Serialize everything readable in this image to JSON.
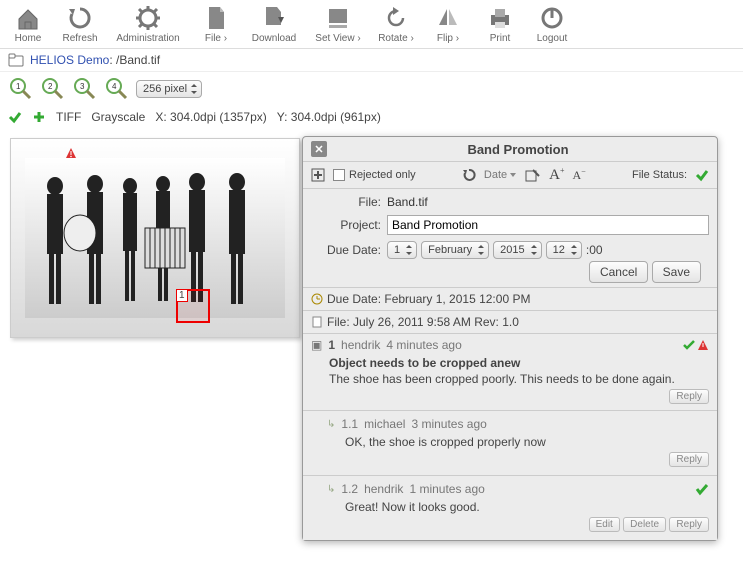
{
  "toolbar": [
    {
      "label": "Home"
    },
    {
      "label": "Refresh"
    },
    {
      "label": "Administration"
    },
    {
      "label": "File ›"
    },
    {
      "label": "Download"
    },
    {
      "label": "Set View ›"
    },
    {
      "label": "Rotate ›"
    },
    {
      "label": "Flip ›"
    },
    {
      "label": "Print"
    },
    {
      "label": "Logout"
    }
  ],
  "path": {
    "prefix": "HELIOS Demo",
    "sep": ": ",
    "file": "/Band.tif"
  },
  "zoom": {
    "select": "256 pixel"
  },
  "info": {
    "format": "TIFF",
    "colorspace": "Grayscale",
    "x": "X:  304.0dpi (1357px)",
    "y": "Y:  304.0dpi (961px)"
  },
  "marker": {
    "num": "1"
  },
  "panel": {
    "title": "Band Promotion",
    "rejected_label": "Rejected only",
    "date_label": "Date",
    "filestatus_label": "File Status:",
    "file_label": "File:",
    "file_value": "Band.tif",
    "project_label": "Project:",
    "project_value": "Band Promotion",
    "due_label": "Due Date:",
    "day": "1",
    "month": "February",
    "year": "2015",
    "hour": "12",
    "time_suffix": ":00",
    "cancel": "Cancel",
    "save": "Save",
    "due_row": "Due Date: February 1, 2015 12:00 PM",
    "file_row": "File: July 26, 2011 9:58 AM  Rev: 1.0",
    "c1": {
      "num": "1",
      "user": "hendrik",
      "time": "4 minutes ago",
      "title": "Object needs to be cropped anew",
      "body": "The shoe has been cropped poorly. This needs to be done again."
    },
    "reply_label": "Reply",
    "c11": {
      "num": "1.1",
      "user": "michael",
      "time": "3 minutes ago",
      "body": "OK, the shoe is cropped properly now"
    },
    "c12": {
      "num": "1.2",
      "user": "hendrik",
      "time": "1 minutes ago",
      "body": "Great! Now it looks good."
    },
    "edit": "Edit",
    "delete": "Delete"
  }
}
